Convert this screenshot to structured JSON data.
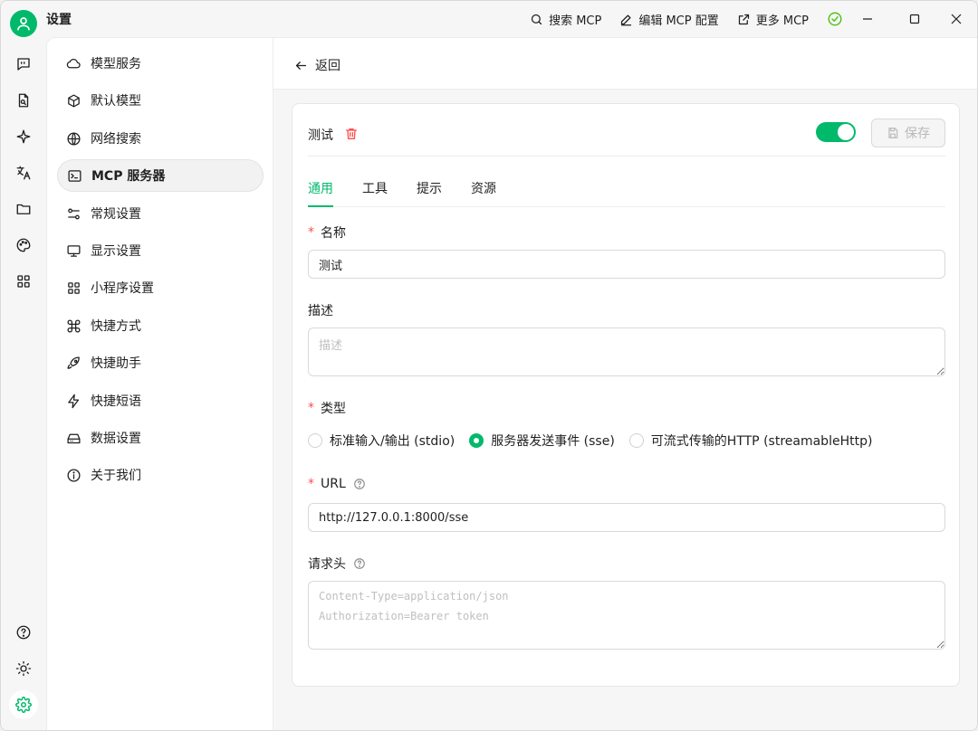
{
  "app": {
    "title": "设置",
    "accent": "#00b96b"
  },
  "titlebar": {
    "actions": [
      {
        "icon": "search-icon",
        "label": "搜索 MCP"
      },
      {
        "icon": "edit-icon",
        "label": "编辑 MCP 配置"
      },
      {
        "icon": "external-link-icon",
        "label": "更多 MCP"
      }
    ]
  },
  "nav": {
    "items": [
      {
        "label": "模型服务",
        "icon": "cloud-icon"
      },
      {
        "label": "默认模型",
        "icon": "cube-icon"
      },
      {
        "label": "网络搜索",
        "icon": "globe-icon"
      },
      {
        "label": "MCP 服务器",
        "icon": "terminal-icon",
        "active": true
      },
      {
        "label": "常规设置",
        "icon": "sliders-icon"
      },
      {
        "label": "显示设置",
        "icon": "monitor-icon"
      },
      {
        "label": "小程序设置",
        "icon": "grid-icon"
      },
      {
        "label": "快捷方式",
        "icon": "command-icon"
      },
      {
        "label": "快捷助手",
        "icon": "rocket-icon"
      },
      {
        "label": "快捷短语",
        "icon": "zap-icon"
      },
      {
        "label": "数据设置",
        "icon": "hard-drive-icon"
      },
      {
        "label": "关于我们",
        "icon": "info-icon"
      }
    ]
  },
  "main": {
    "back_label": "返回",
    "server_name": "测试",
    "enabled": true,
    "save_label": "保存",
    "tabs": [
      {
        "label": "通用",
        "active": true
      },
      {
        "label": "工具"
      },
      {
        "label": "提示"
      },
      {
        "label": "资源"
      }
    ],
    "form": {
      "name_label": "名称",
      "name_value": "测试",
      "desc_label": "描述",
      "desc_placeholder": "描述",
      "type_label": "类型",
      "type_options": [
        {
          "label": "标准输入/输出 (stdio)",
          "checked": false
        },
        {
          "label": "服务器发送事件 (sse)",
          "checked": true
        },
        {
          "label": "可流式传输的HTTP (streamableHttp)",
          "checked": false
        }
      ],
      "url_label": "URL",
      "url_value": "http://127.0.0.1:8000/sse",
      "headers_label": "请求头",
      "headers_placeholder": "Content-Type=application/json\nAuthorization=Bearer token"
    }
  }
}
